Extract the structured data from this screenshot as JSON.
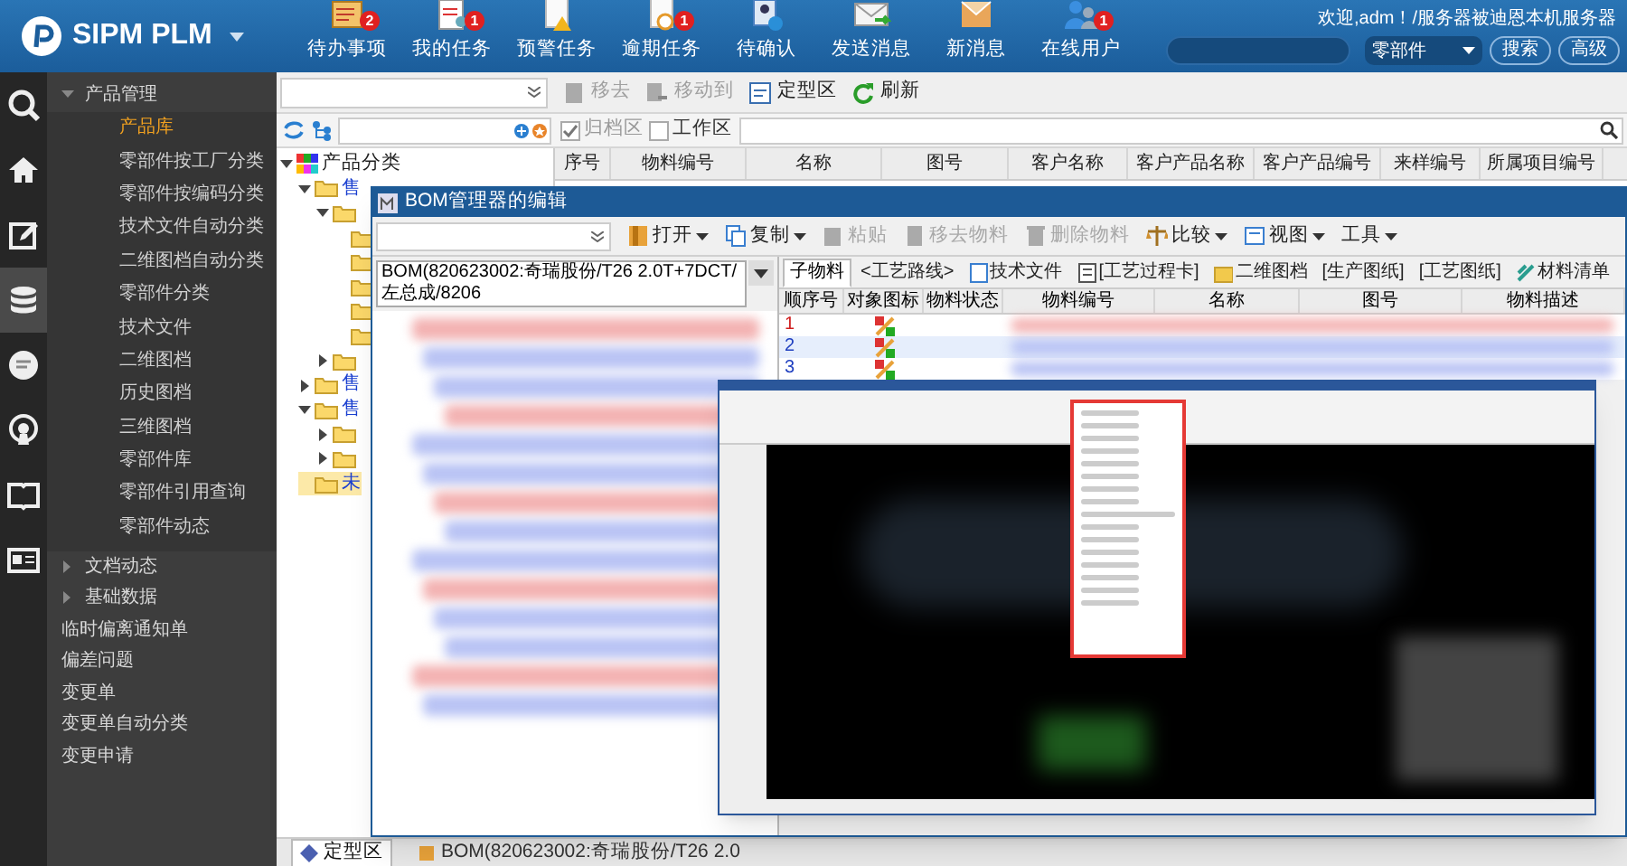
{
  "app": {
    "title": "SIPM PLM",
    "welcome": "欢迎,adm！/服务器被迪恩本机服务器"
  },
  "nav": [
    {
      "label": "待办事项",
      "badge": "2",
      "kind": "todo"
    },
    {
      "label": "我的任务",
      "badge": "1",
      "kind": "task"
    },
    {
      "label": "预警任务",
      "kind": "warn"
    },
    {
      "label": "逾期任务",
      "badge": "1",
      "kind": "overdue"
    },
    {
      "label": "待确认",
      "kind": "confirm"
    },
    {
      "label": "发送消息",
      "kind": "send"
    },
    {
      "label": "新消息",
      "kind": "inbox"
    },
    {
      "label": "在线用户",
      "badge": "1",
      "kind": "users"
    }
  ],
  "search": {
    "scope": "零部件",
    "buttons": [
      "搜索",
      "高级"
    ]
  },
  "rail": [
    {
      "kind": "search",
      "selected": false
    },
    {
      "kind": "home",
      "selected": false
    },
    {
      "kind": "edit",
      "selected": false
    },
    {
      "kind": "database",
      "selected": true
    },
    {
      "kind": "chat",
      "selected": false
    },
    {
      "kind": "signal",
      "selected": false
    },
    {
      "kind": "book",
      "selected": false
    },
    {
      "kind": "card",
      "selected": false
    }
  ],
  "menu": [
    {
      "label": "产品管理",
      "expanded": true,
      "children": [
        {
          "label": "产品库",
          "selected": true
        },
        {
          "label": "零部件按工厂分类",
          "selected": false
        },
        {
          "label": "零部件按编码分类",
          "selected": false
        },
        {
          "label": "技术文件自动分类",
          "selected": false
        },
        {
          "label": "二维图档自动分类",
          "selected": false
        },
        {
          "label": "零部件分类",
          "selected": false
        },
        {
          "label": "技术文件",
          "selected": false
        },
        {
          "label": "二维图档",
          "selected": false
        },
        {
          "label": "历史图档",
          "selected": false
        },
        {
          "label": "三维图档",
          "selected": false
        },
        {
          "label": "零部件库",
          "selected": false
        },
        {
          "label": "零部件引用查询",
          "selected": false
        },
        {
          "label": "零部件动态",
          "selected": false
        }
      ]
    },
    {
      "label": "文档动态",
      "expanded": false
    },
    {
      "label": "基础数据",
      "expanded": false
    },
    {
      "label": "临时偏离通知单"
    },
    {
      "label": "偏差问题"
    },
    {
      "label": "变更单"
    },
    {
      "label": "变更单自动分类"
    },
    {
      "label": "变更申请"
    }
  ],
  "toolbar": [
    {
      "label": "移去",
      "disabled": true,
      "kind": "remove"
    },
    {
      "label": "移动到",
      "disabled": true,
      "kind": "move"
    },
    {
      "label": "定型区",
      "disabled": false,
      "kind": "final"
    },
    {
      "label": "刷新",
      "disabled": false,
      "kind": "refresh"
    }
  ],
  "filters": [
    {
      "label": "归档区",
      "checked": true,
      "disabled": true
    },
    {
      "label": "工作区",
      "checked": false,
      "disabled": false
    }
  ],
  "tree": [
    {
      "label": "产品分类",
      "expanded": true,
      "selected": false,
      "kind": "root",
      "children": [
        {
          "label": "售",
          "expanded": true,
          "selected": false,
          "kind": "folder",
          "children": [
            {
              "expanded": true,
              "selected": false,
              "kind": "folder",
              "children": [
                {
                  "selected": false,
                  "kind": "folder"
                },
                {
                  "selected": false,
                  "kind": "folder"
                },
                {
                  "selected": false,
                  "kind": "folder"
                },
                {
                  "selected": false,
                  "kind": "folder"
                },
                {
                  "selected": false,
                  "kind": "folder"
                }
              ]
            },
            {
              "expanded": false,
              "selected": false,
              "kind": "folder"
            }
          ]
        },
        {
          "label": "售",
          "expanded": false,
          "selected": false,
          "kind": "folder"
        },
        {
          "label": "售",
          "expanded": true,
          "selected": false,
          "kind": "folder",
          "children": [
            {
              "expanded": false,
              "selected": false,
              "kind": "folder"
            },
            {
              "expanded": false,
              "selected": false,
              "kind": "folder"
            }
          ]
        },
        {
          "label": "未",
          "selected": true,
          "kind": "folder"
        }
      ]
    }
  ],
  "table": {
    "columns": [
      "序号",
      "物料编号",
      "名称",
      "图号",
      "客户名称",
      "客户产品名称",
      "客户产品编号",
      "来样编号",
      "所属项目编号"
    ]
  },
  "bottom_tabs": [
    {
      "label": "定型区",
      "selected": true
    },
    {
      "label": "BOM(820623002:奇瑞股份/T26 2.0",
      "selected": false
    }
  ],
  "bom": {
    "title": "BOM管理器的编辑",
    "toolbar": [
      {
        "label": "打开",
        "disabled": false,
        "menu": true,
        "kind": "open"
      },
      {
        "label": "复制",
        "disabled": false,
        "menu": true,
        "kind": "copy"
      },
      {
        "label": "粘贴",
        "disabled": true,
        "menu": false,
        "kind": "paste"
      },
      {
        "label": "移去物料",
        "disabled": true,
        "menu": false,
        "kind": "remove"
      },
      {
        "label": "删除物料",
        "disabled": true,
        "menu": false,
        "kind": "delete"
      },
      {
        "label": "比较",
        "disabled": false,
        "menu": true,
        "kind": "compare"
      },
      {
        "label": "视图",
        "disabled": false,
        "menu": true,
        "kind": "view"
      },
      {
        "label": "工具",
        "disabled": false,
        "menu": true,
        "kind": "tools"
      }
    ],
    "selector": "BOM(820623002:奇瑞股份/T26 2.0T+7DCT/左总成/8206",
    "tabs": [
      {
        "label": "子物料",
        "selected": true,
        "kind": "plain"
      },
      {
        "label": "<工艺路线>",
        "selected": false,
        "kind": "plain"
      },
      {
        "label": "技术文件",
        "selected": false,
        "kind": "doc"
      },
      {
        "label": "[工艺过程卡]",
        "selected": false,
        "kind": "card"
      },
      {
        "label": "二维图档",
        "selected": false,
        "kind": "folder"
      },
      {
        "label": "[生产图纸]",
        "selected": false,
        "kind": "plain"
      },
      {
        "label": "[工艺图纸]",
        "selected": false,
        "kind": "plain"
      },
      {
        "label": "材料清单",
        "selected": false,
        "kind": "list"
      }
    ],
    "columns": [
      "顺序号",
      "对象图标",
      "物料状态",
      "物料编号",
      "名称",
      "图号",
      "物料描述"
    ],
    "rows": [
      {
        "index": "1",
        "selected": false
      },
      {
        "index": "2",
        "selected": true
      },
      {
        "index": "3",
        "selected": false
      }
    ]
  }
}
